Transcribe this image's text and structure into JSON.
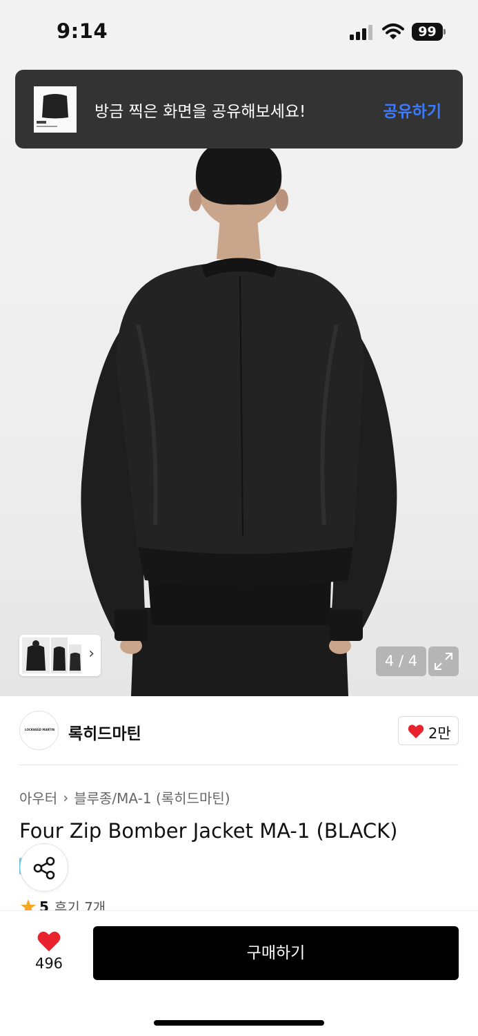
{
  "status_bar": {
    "time": "9:14",
    "battery": "99"
  },
  "toast": {
    "message": "방금 찍은 화면을 공유해보세요!",
    "action": "공유하기"
  },
  "gallery": {
    "counter": "4 / 4"
  },
  "brand": {
    "name": "록히드마틴",
    "logo_text": "LOCKHEED MARTIN",
    "like_count": "2만"
  },
  "breadcrumb": {
    "items": [
      "아우터",
      "블루종/MA-1 (록히드마틴)"
    ]
  },
  "product": {
    "title": "Four Zip Bomber Jacket MA-1 (BLACK)"
  },
  "rating": {
    "score": "5",
    "reviews": "후기 7개"
  },
  "bottom_bar": {
    "wish_count": "496",
    "buy_label": "구매하기"
  },
  "colors": {
    "accent_blue": "#3b7bff",
    "heart_red": "#e8232d",
    "star": "#f5a623",
    "toast_bg": "#333333",
    "button_bg": "#000000"
  },
  "icons": [
    "signal-icon",
    "wifi-icon",
    "battery-icon",
    "chevron-right-icon",
    "expand-icon",
    "heart-icon",
    "share-icon",
    "star-icon"
  ]
}
